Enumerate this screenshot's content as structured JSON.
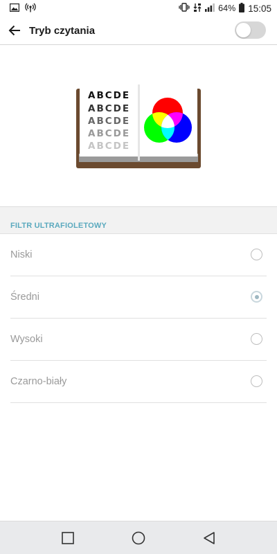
{
  "status_bar": {
    "battery_percent": "64%",
    "time": "15:05"
  },
  "app_bar": {
    "title": "Tryb czytania",
    "toggle_on": false
  },
  "illustration": {
    "letter_rows": [
      "ABCDE",
      "ABCDE",
      "ABCDE",
      "ABCDE",
      "ABCDE"
    ]
  },
  "section": {
    "title": "FILTR ULTRAFIOLETOWY",
    "options": [
      {
        "label": "Niski",
        "selected": false
      },
      {
        "label": "Średni",
        "selected": true
      },
      {
        "label": "Wysoki",
        "selected": false
      },
      {
        "label": "Czarno-biały",
        "selected": false
      }
    ]
  },
  "colors": {
    "accent": "#5aa9be",
    "book_cover": "#6b4a2f",
    "rgb_red": "#ff0000",
    "rgb_green": "#00ff00",
    "rgb_blue": "#0000ff"
  }
}
